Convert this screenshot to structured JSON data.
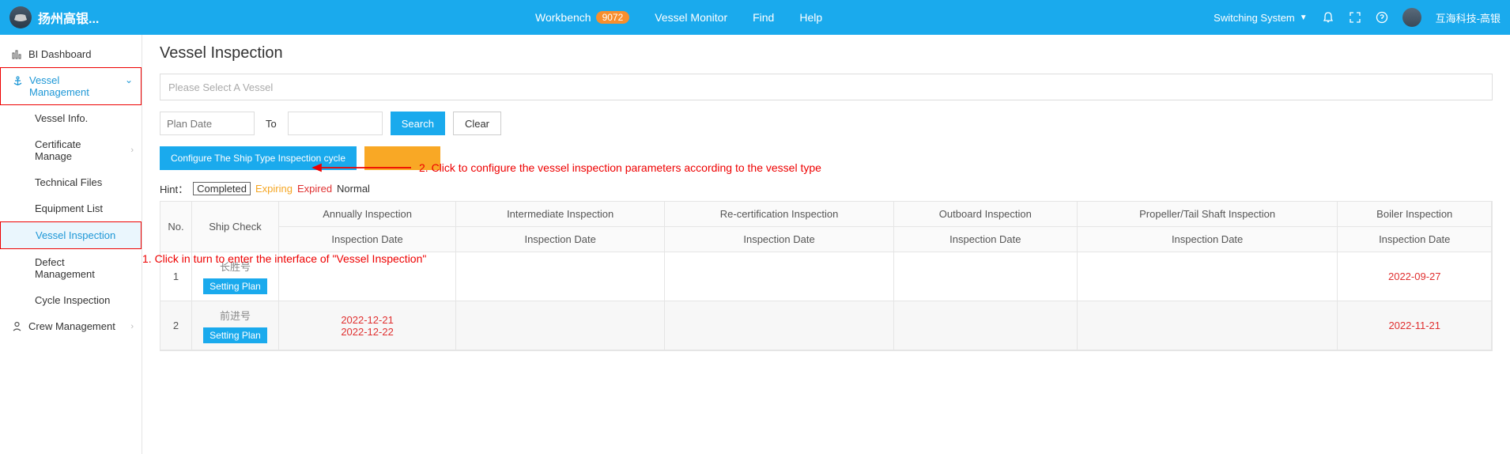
{
  "header": {
    "logo_text": "扬州高银...",
    "workbench": "Workbench",
    "workbench_badge": "9072",
    "vessel_monitor": "Vessel Monitor",
    "find": "Find",
    "help": "Help",
    "switching": "Switching System",
    "username": "互海科技-高银"
  },
  "sidebar": {
    "bi_dashboard": "BI Dashboard",
    "vessel_mgmt": "Vessel Management",
    "items": [
      {
        "label": "Vessel Info."
      },
      {
        "label": "Certificate Manage"
      },
      {
        "label": "Technical Files"
      },
      {
        "label": "Equipment List"
      },
      {
        "label": "Vessel Inspection"
      },
      {
        "label": "Defect Management"
      },
      {
        "label": "Cycle Inspection"
      }
    ],
    "crew_mgmt": "Crew Management"
  },
  "page": {
    "title": "Vessel Inspection",
    "vessel_placeholder": "Please Select A Vessel",
    "plan_date_ph": "Plan Date",
    "to_label": "To",
    "search": "Search",
    "clear": "Clear",
    "configure_btn": "Configure The Ship Type Inspection cycle",
    "hint_label": "Hint：",
    "hint_completed": "Completed",
    "hint_expiring": "Expiring",
    "hint_expired": "Expired",
    "hint_normal": "Normal",
    "setting_plan": "Setting Plan"
  },
  "table": {
    "col_no": "No.",
    "col_ship_check": "Ship Check",
    "col_annually": "Annually Inspection",
    "col_intermediate": "Intermediate Inspection",
    "col_recert": "Re-certification Inspection",
    "col_outboard": "Outboard Inspection",
    "col_propeller": "Propeller/Tail Shaft Inspection",
    "col_boiler": "Boiler Inspection",
    "sub_inspection_date": "Inspection Date",
    "rows": [
      {
        "no": "1",
        "ship": "长胜号",
        "annually": "",
        "annually2": "",
        "boiler": "2022-09-27"
      },
      {
        "no": "2",
        "ship": "前进号",
        "annually": "2022-12-21",
        "annually2": "2022-12-22",
        "boiler": "2022-11-21"
      }
    ]
  },
  "annotations": {
    "anno1": "1. Click in turn to enter the interface of \"Vessel Inspection\"",
    "anno2": "2. Click to configure the vessel inspection parameters according to the vessel type"
  }
}
